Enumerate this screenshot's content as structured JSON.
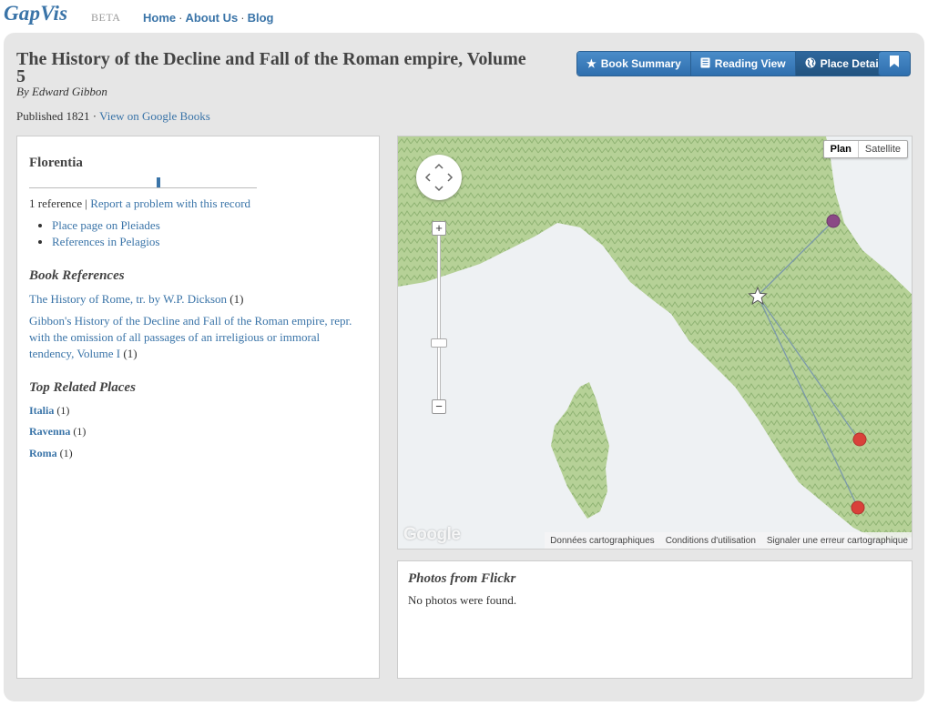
{
  "app": {
    "logo": "GapVis",
    "beta": "BETA"
  },
  "nav": {
    "items": [
      "Home",
      "About Us",
      "Blog"
    ],
    "separator": "·"
  },
  "book": {
    "title": "The History of the Decline and Fall of the Roman empire, Volume 5",
    "author": "By Edward Gibbon",
    "published": "Published 1821 · ",
    "google_link": "View on Google Books"
  },
  "view_buttons": [
    {
      "label": "Book Summary",
      "icon": "star-icon"
    },
    {
      "label": "Reading View",
      "icon": "book-icon"
    },
    {
      "label": "Place Detail",
      "icon": "globe-icon",
      "active": true
    }
  ],
  "bookmark_icon": "bookmark-icon",
  "place": {
    "name": "Florentia",
    "reference_count": "1 reference",
    "sep": " | ",
    "report_link": "Report a problem with this record",
    "links": [
      "Place page on Pleiades",
      "References in Pelagios"
    ]
  },
  "book_references": {
    "heading": "Book References",
    "items": [
      {
        "title": "The History of Rome, tr. by W.P. Dickson",
        "count": " (1)"
      },
      {
        "title": "Gibbon's History of the Decline and Fall of the Roman empire, repr. with the omission of all passages of an irreligious or immoral tendency, Volume I",
        "count": " (1)"
      }
    ]
  },
  "related_places": {
    "heading": "Top Related Places",
    "items": [
      {
        "name": "Italia",
        "count": " (1)"
      },
      {
        "name": "Ravenna",
        "count": " (1)"
      },
      {
        "name": "Roma",
        "count": " (1)"
      }
    ]
  },
  "map": {
    "type_buttons": [
      "Plan",
      "Satellite"
    ],
    "zoom_in": "+",
    "zoom_out": "−",
    "logo": "Google",
    "footer": [
      "Données cartographiques",
      "Conditions d'utilisation",
      "Signaler une erreur cartographique"
    ],
    "colors": {
      "land": "#b9d39c",
      "sea": "#eef1f3",
      "marker_purple": "#8b4a86",
      "marker_red": "#d9413a"
    }
  },
  "flickr": {
    "heading": "Photos from Flickr",
    "message": "No photos were found."
  }
}
